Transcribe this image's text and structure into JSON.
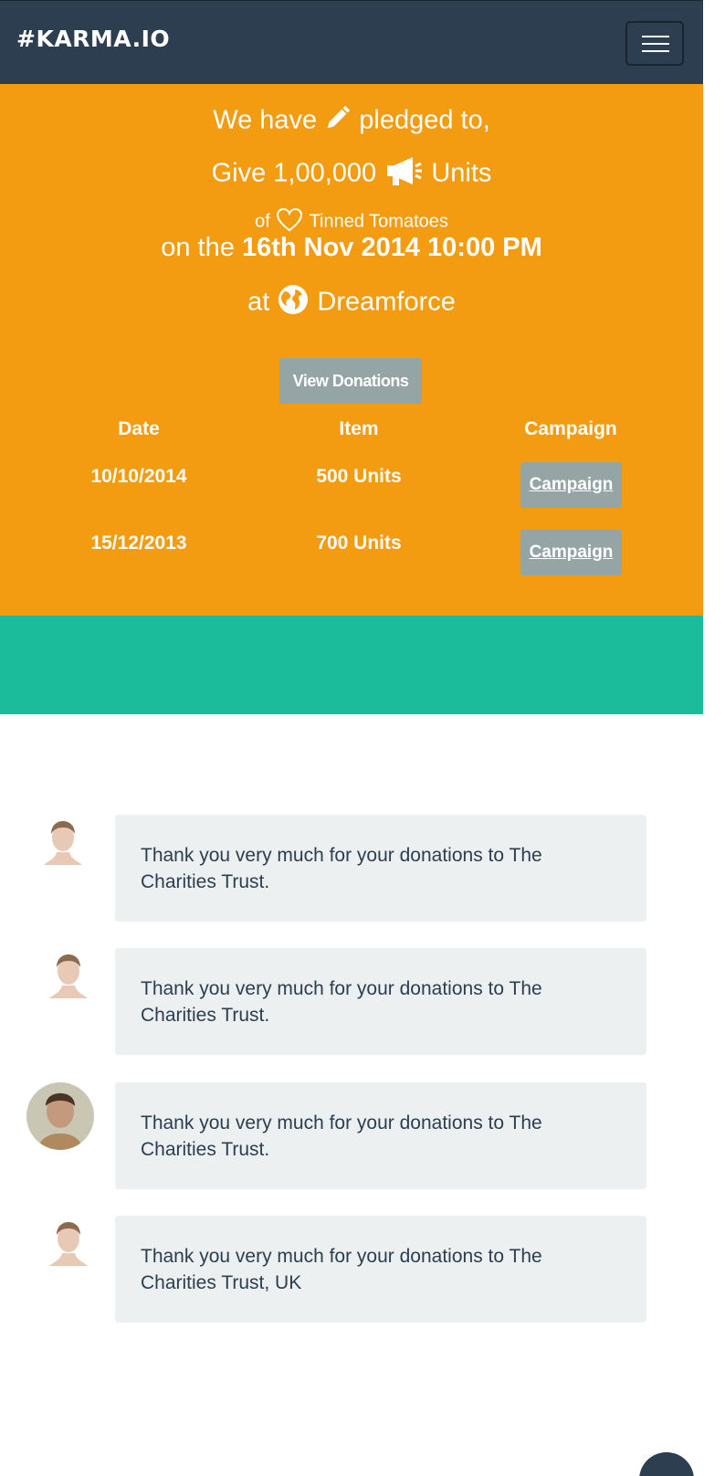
{
  "navbar": {
    "brand": "#KARMA.IO"
  },
  "pledge": {
    "line1_pre": "We have",
    "line1_post": "pledged to,",
    "line2_pre": "Give 1,00,000",
    "line2_post": "Units",
    "line3_pre": "of",
    "line3_item": "Tinned Tomatoes",
    "line4_pre": "on the",
    "line4_date": "16th Nov 2014 10:00 PM",
    "line5_pre": "at",
    "line5_place": "Dreamforce"
  },
  "donations": {
    "button": "View Donations",
    "headers": [
      "Date",
      "Item",
      "Campaign"
    ],
    "rows": [
      {
        "date": "10/10/2014",
        "item": "500 Units",
        "campaign": "Campaign"
      },
      {
        "date": "15/12/2013",
        "item": "700 Units",
        "campaign": "Campaign"
      }
    ]
  },
  "messages": [
    {
      "text": "Thank you very much for your donations to The Charities Trust."
    },
    {
      "text": "Thank you very much for your donations to The Charities Trust."
    },
    {
      "text": "Thank you very much for your donations to The Charities Trust."
    },
    {
      "text": "Thank you very much for your donations to The Charities Trust, UK"
    }
  ],
  "colors": {
    "navbar": "#2c3e50",
    "hero": "#f39c12",
    "band": "#1abc9c",
    "button": "#95a5a6",
    "bubble": "#ecf0f1"
  },
  "icons": [
    "pencil-icon",
    "megaphone-icon",
    "heart-icon",
    "globe-icon",
    "menu-icon"
  ]
}
